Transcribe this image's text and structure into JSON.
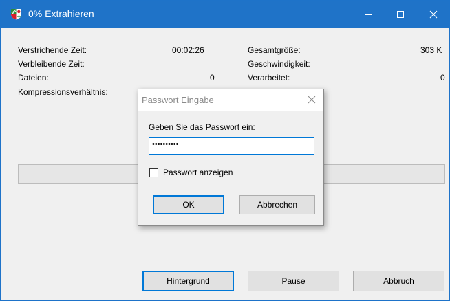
{
  "window": {
    "title": "0% Extrahieren",
    "accent_color": "#1f73c8"
  },
  "stats_left": [
    {
      "label": "Verstrichende Zeit:",
      "value": "00:02:26"
    },
    {
      "label": "Verbleibende Zeit:",
      "value": ""
    },
    {
      "label": "Dateien:",
      "value": "0"
    },
    {
      "label": "Kompressionsverhältnis:",
      "value": ""
    }
  ],
  "stats_right": [
    {
      "label": "Gesamtgröße:",
      "value": "303 K"
    },
    {
      "label": "Geschwindigkeit:",
      "value": ""
    },
    {
      "label": "Verarbeitet:",
      "value": "0"
    }
  ],
  "progress": {
    "fraction": 0
  },
  "buttons": {
    "background": "Hintergrund",
    "pause": "Pause",
    "abort": "Abbruch"
  },
  "password_dialog": {
    "title": "Passwort Eingabe",
    "prompt": "Geben Sie das Passwort ein:",
    "password_value": "••••••••••",
    "show_password_label": "Passwort anzeigen",
    "show_password_checked": false,
    "ok_label": "OK",
    "cancel_label": "Abbrechen"
  },
  "icons": {
    "app": "nrw-coat-of-arms-icon",
    "minimize": "minimize-icon",
    "maximize": "maximize-icon",
    "close": "close-icon",
    "dialog_close": "close-icon"
  }
}
